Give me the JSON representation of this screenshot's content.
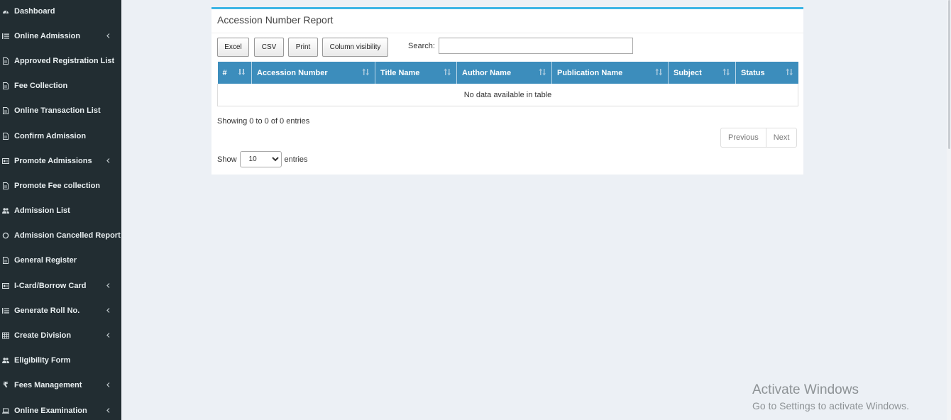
{
  "sidebar": {
    "items": [
      {
        "label": "Dashboard",
        "icon": "dashboard-icon",
        "has_submenu": false
      },
      {
        "label": "Online Admission",
        "icon": "list-icon",
        "has_submenu": true
      },
      {
        "label": "Approved Registration List",
        "icon": "file-icon",
        "has_submenu": false
      },
      {
        "label": "Fee Collection",
        "icon": "file-icon",
        "has_submenu": false
      },
      {
        "label": "Online Transaction List",
        "icon": "file-icon",
        "has_submenu": false
      },
      {
        "label": "Confirm Admission",
        "icon": "file-icon",
        "has_submenu": false
      },
      {
        "label": "Promote Admissions",
        "icon": "id-card-icon",
        "has_submenu": true
      },
      {
        "label": "Promote Fee collection",
        "icon": "file-icon",
        "has_submenu": false
      },
      {
        "label": "Admission List",
        "icon": "users-icon",
        "has_submenu": false
      },
      {
        "label": "Admission Cancelled Report",
        "icon": "circle-icon",
        "has_submenu": false
      },
      {
        "label": "General Register",
        "icon": "file-icon",
        "has_submenu": false
      },
      {
        "label": "I-Card/Borrow Card",
        "icon": "id-card-icon",
        "has_submenu": true
      },
      {
        "label": "Generate Roll No.",
        "icon": "list-icon",
        "has_submenu": true
      },
      {
        "label": "Create Division",
        "icon": "table-icon",
        "has_submenu": true
      },
      {
        "label": "Eligibility Form",
        "icon": "users-icon",
        "has_submenu": false
      },
      {
        "label": "Fees Management",
        "icon": "rupee-icon",
        "has_submenu": true
      },
      {
        "label": "Online Examination",
        "icon": "laptop-icon",
        "has_submenu": true
      }
    ]
  },
  "report": {
    "title": "Accession Number Report",
    "buttons": {
      "excel": "Excel",
      "csv": "CSV",
      "print": "Print",
      "colvis": "Column visibility"
    },
    "search": {
      "label": "Search:",
      "value": "",
      "placeholder": ""
    },
    "columns": [
      "#",
      "Accession Number",
      "Title Name",
      "Author Name",
      "Publication Name",
      "Subject",
      "Status"
    ],
    "empty_message": "No data available in table",
    "info": "Showing 0 to 0 of 0 entries",
    "pagination": {
      "previous": "Previous",
      "next": "Next"
    },
    "length": {
      "show": "Show",
      "selected": "10",
      "entries": "entries"
    }
  },
  "watermark": {
    "title": "Activate Windows",
    "subtitle": "Go to Settings to activate Windows."
  },
  "colors": {
    "sidebar_bg": "#222d32",
    "header_bg": "#3c8dbc",
    "box_top_border": "#3cb5e5",
    "page_bg": "#ecf0f5"
  }
}
